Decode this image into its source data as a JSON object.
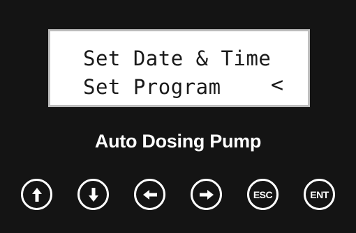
{
  "display": {
    "line1": "Set Date & Time",
    "line2": "Set Program",
    "cursor": "<"
  },
  "device": {
    "label": "Auto Dosing Pump"
  },
  "buttons": {
    "esc_label": "ESC",
    "ent_label": "ENT",
    "icons": [
      "arrow-up-icon",
      "arrow-down-icon",
      "arrow-left-icon",
      "arrow-right-icon"
    ]
  },
  "colors": {
    "panel": "#141414",
    "lcd_background": "#ffffff",
    "lcd_text": "#1a1a1a",
    "button_outline": "#ffffff"
  }
}
